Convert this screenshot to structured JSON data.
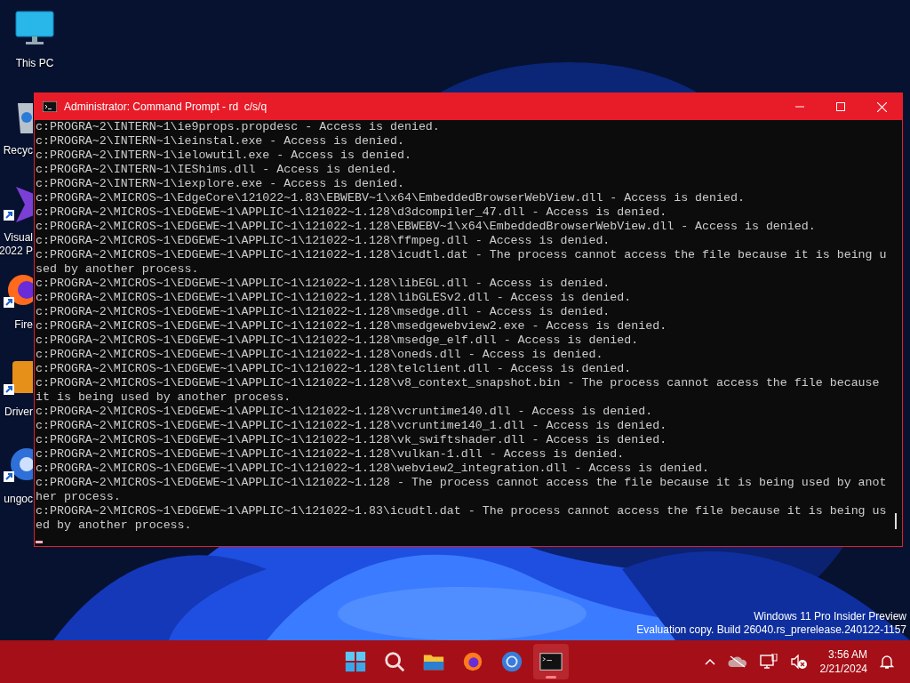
{
  "desktop_icons": [
    {
      "kind": "computer",
      "label_lines": [
        "This PC"
      ],
      "shortcut": false
    },
    {
      "kind": "bin",
      "label_lines": [
        "Recyc"
      ],
      "shortcut": false
    },
    {
      "kind": "ide",
      "label_lines": [
        "Visual",
        "2022 P"
      ],
      "shortcut": true
    },
    {
      "kind": "fox",
      "label_lines": [
        "Fire"
      ],
      "shortcut": true
    },
    {
      "kind": "driver",
      "label_lines": [
        "Driver"
      ],
      "shortcut": true
    },
    {
      "kind": "browser",
      "label_lines": [
        "ungoc"
      ],
      "shortcut": true
    }
  ],
  "window": {
    "title": "Administrator: Command Prompt - rd  c/s/q",
    "console_lines": [
      "c:PROGRA~2\\INTERN~1\\ie9props.propdesc - Access is denied.",
      "c:PROGRA~2\\INTERN~1\\ieinstal.exe - Access is denied.",
      "c:PROGRA~2\\INTERN~1\\ielowutil.exe - Access is denied.",
      "c:PROGRA~2\\INTERN~1\\IEShims.dll - Access is denied.",
      "c:PROGRA~2\\INTERN~1\\iexplore.exe - Access is denied.",
      "c:PROGRA~2\\MICROS~1\\EdgeCore\\121022~1.83\\EBWEBV~1\\x64\\EmbeddedBrowserWebView.dll - Access is denied.",
      "c:PROGRA~2\\MICROS~1\\EDGEWE~1\\APPLIC~1\\121022~1.128\\d3dcompiler_47.dll - Access is denied.",
      "c:PROGRA~2\\MICROS~1\\EDGEWE~1\\APPLIC~1\\121022~1.128\\EBWEBV~1\\x64\\EmbeddedBrowserWebView.dll - Access is denied.",
      "c:PROGRA~2\\MICROS~1\\EDGEWE~1\\APPLIC~1\\121022~1.128\\ffmpeg.dll - Access is denied.",
      "c:PROGRA~2\\MICROS~1\\EDGEWE~1\\APPLIC~1\\121022~1.128\\icudtl.dat - The process cannot access the file because it is being u",
      "sed by another process.",
      "c:PROGRA~2\\MICROS~1\\EDGEWE~1\\APPLIC~1\\121022~1.128\\libEGL.dll - Access is denied.",
      "c:PROGRA~2\\MICROS~1\\EDGEWE~1\\APPLIC~1\\121022~1.128\\libGLESv2.dll - Access is denied.",
      "c:PROGRA~2\\MICROS~1\\EDGEWE~1\\APPLIC~1\\121022~1.128\\msedge.dll - Access is denied.",
      "c:PROGRA~2\\MICROS~1\\EDGEWE~1\\APPLIC~1\\121022~1.128\\msedgewebview2.exe - Access is denied.",
      "c:PROGRA~2\\MICROS~1\\EDGEWE~1\\APPLIC~1\\121022~1.128\\msedge_elf.dll - Access is denied.",
      "c:PROGRA~2\\MICROS~1\\EDGEWE~1\\APPLIC~1\\121022~1.128\\oneds.dll - Access is denied.",
      "c:PROGRA~2\\MICROS~1\\EDGEWE~1\\APPLIC~1\\121022~1.128\\telclient.dll - Access is denied.",
      "c:PROGRA~2\\MICROS~1\\EDGEWE~1\\APPLIC~1\\121022~1.128\\v8_context_snapshot.bin - The process cannot access the file because",
      "it is being used by another process.",
      "c:PROGRA~2\\MICROS~1\\EDGEWE~1\\APPLIC~1\\121022~1.128\\vcruntime140.dll - Access is denied.",
      "c:PROGRA~2\\MICROS~1\\EDGEWE~1\\APPLIC~1\\121022~1.128\\vcruntime140_1.dll - Access is denied.",
      "c:PROGRA~2\\MICROS~1\\EDGEWE~1\\APPLIC~1\\121022~1.128\\vk_swiftshader.dll - Access is denied.",
      "c:PROGRA~2\\MICROS~1\\EDGEWE~1\\APPLIC~1\\121022~1.128\\vulkan-1.dll - Access is denied.",
      "c:PROGRA~2\\MICROS~1\\EDGEWE~1\\APPLIC~1\\121022~1.128\\webview2_integration.dll - Access is denied.",
      "c:PROGRA~2\\MICROS~1\\EDGEWE~1\\APPLIC~1\\121022~1.128 - The process cannot access the file because it is being used by anot",
      "her process.",
      "c:PROGRA~2\\MICROS~1\\EDGEWE~1\\APPLIC~1\\121022~1.83\\icudtl.dat - The process cannot access the file because it is being us",
      "ed by another process."
    ]
  },
  "watermark_lines": [
    "Windows 11 Pro Insider Preview",
    "Evaluation copy. Build 26040.rs_prerelease.240122-1157"
  ],
  "taskbar": {
    "apps": [
      {
        "kind": "start",
        "selected": false
      },
      {
        "kind": "search",
        "selected": false
      },
      {
        "kind": "folder",
        "selected": false
      },
      {
        "kind": "fox",
        "selected": false
      },
      {
        "kind": "browser",
        "selected": false
      },
      {
        "kind": "terminal",
        "selected": true
      }
    ],
    "tray": {
      "time": "3:56 AM",
      "date": "2/21/2024"
    }
  }
}
